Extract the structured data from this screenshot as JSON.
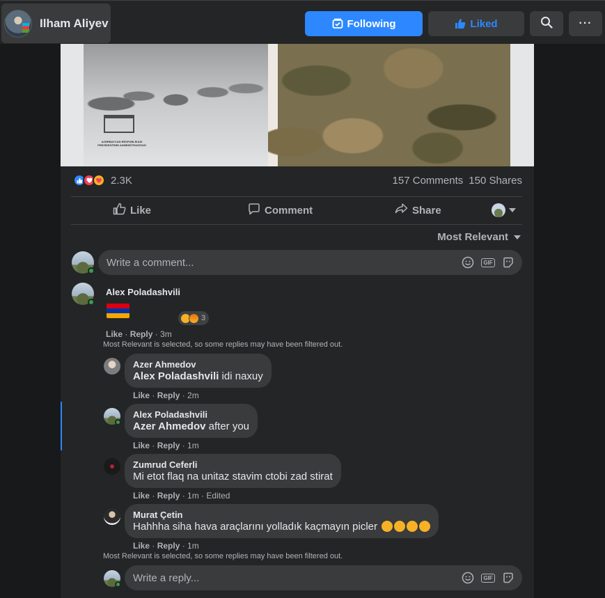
{
  "page": {
    "name": "Ilham Aliyev"
  },
  "header": {
    "following_label": "Following",
    "liked_label": "Liked",
    "search_icon": "search-icon",
    "more_icon": "more-icon",
    "more_glyph": "···"
  },
  "post": {
    "image_caption": "AZƏRBAYCAN RESPUBLİKASI PREZİDENTİNİN ADMİNİSTRASİYASI",
    "reaction_count": "2.3K",
    "comments_count": "157 Comments",
    "shares_count": "150 Shares",
    "actions": {
      "like": "Like",
      "comment": "Comment",
      "share": "Share"
    },
    "sort_label": "Most Relevant",
    "comment_placeholder": "Write a comment..."
  },
  "comments": {
    "top": {
      "author": "Alex Poladashvili",
      "reaction_count": "3",
      "like": "Like",
      "reply": "Reply",
      "time": "3m",
      "filter_note": "Most Relevant is selected, so some replies may have been filtered out."
    },
    "replies": [
      {
        "author": "Azer Ahmedov",
        "mention": "Alex Poladashvili",
        "text": " idi naxuy",
        "like": "Like",
        "reply": "Reply",
        "time": "2m",
        "edited": ""
      },
      {
        "author": "Alex Poladashvili",
        "mention": "Azer Ahmedov",
        "text": " after you",
        "like": "Like",
        "reply": "Reply",
        "time": "1m",
        "edited": ""
      },
      {
        "author": "Zumrud Ceferli",
        "mention": "",
        "text": "Mi etot flaq na unitaz stavim ctobi zad stirat",
        "like": "Like",
        "reply": "Reply",
        "time": "1m",
        "edited": "Edited"
      },
      {
        "author": "Murat Çetin",
        "mention": "",
        "text": "Hahhha siha hava araçlarını yolladık kaçmayın picler",
        "like": "Like",
        "reply": "Reply",
        "time": "1m",
        "edited": ""
      }
    ],
    "bottom_filter_note": "Most Relevant is selected, so some replies may have been filtered out.",
    "reply_placeholder": "Write a reply..."
  }
}
